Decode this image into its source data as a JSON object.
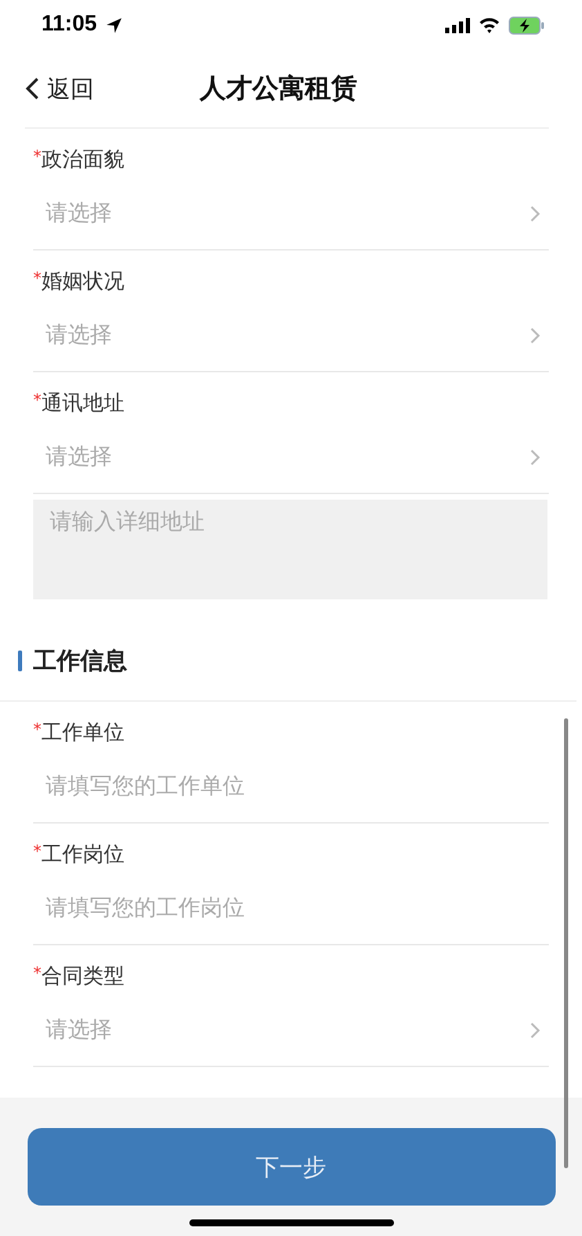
{
  "status_bar": {
    "time": "11:05"
  },
  "nav": {
    "back": "返回",
    "title": "人才公寓租赁"
  },
  "sections": [
    {
      "fields": [
        {
          "kind": "select",
          "mark": "*",
          "label": "政治面貌",
          "placeholder": "请选择"
        },
        {
          "kind": "select",
          "mark": "*",
          "label": "婚姻状况",
          "placeholder": "请选择"
        },
        {
          "kind": "select",
          "mark": "*",
          "label": "通讯地址",
          "placeholder": "请选择"
        },
        {
          "kind": "textarea",
          "placeholder": "请输入详细地址"
        }
      ]
    },
    {
      "heading": "工作信息",
      "fields": [
        {
          "kind": "text",
          "mark": "*",
          "label": "工作单位",
          "placeholder": "请填写您的工作单位"
        },
        {
          "kind": "text",
          "mark": "*",
          "label": "工作岗位",
          "placeholder": "请填写您的工作岗位"
        },
        {
          "kind": "select",
          "mark": "*",
          "label": "合同类型",
          "placeholder": "请选择"
        }
      ]
    }
  ],
  "footer": {
    "button": "下一步"
  }
}
